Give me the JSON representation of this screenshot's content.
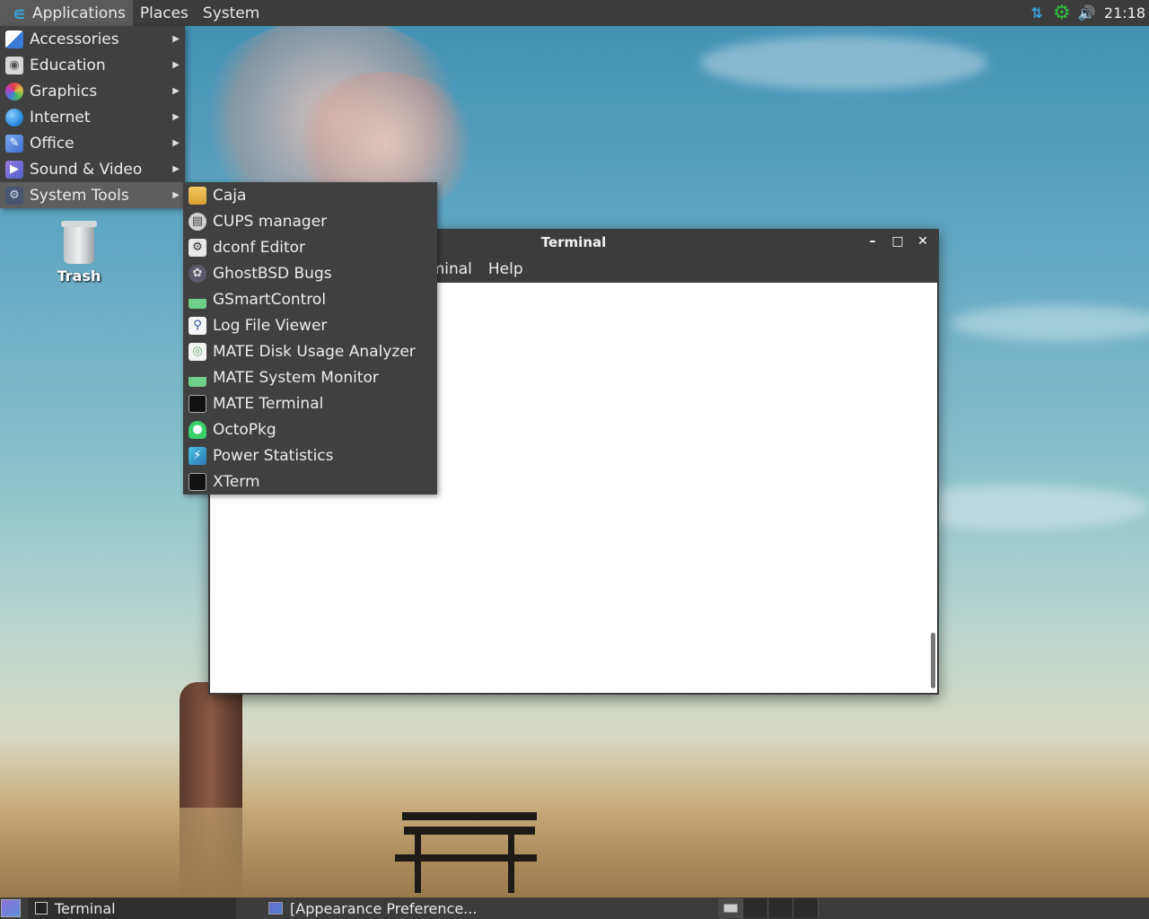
{
  "top_panel": {
    "menus": [
      "Applications",
      "Places",
      "System"
    ],
    "clock": "21:18",
    "tray_icons": [
      "network-icon",
      "update-gear-icon",
      "volume-icon"
    ]
  },
  "applications_menu": {
    "items": [
      {
        "label": "Accessories",
        "icon": "accessories-icon",
        "color": "#3b7ad6"
      },
      {
        "label": "Education",
        "icon": "education-icon",
        "color": "#cfcfcf"
      },
      {
        "label": "Graphics",
        "icon": "graphics-icon",
        "color": "#e04040"
      },
      {
        "label": "Internet",
        "icon": "internet-icon",
        "color": "#2d8ce0"
      },
      {
        "label": "Office",
        "icon": "office-icon",
        "color": "#5a8fe0"
      },
      {
        "label": "Sound & Video",
        "icon": "sound-video-icon",
        "color": "#7a5ad0"
      },
      {
        "label": "System Tools",
        "icon": "system-tools-icon",
        "color": "#9aa8c8"
      }
    ],
    "selected": "System Tools"
  },
  "system_tools_menu": {
    "items": [
      {
        "label": "Caja",
        "icon": "folder-icon"
      },
      {
        "label": "CUPS manager",
        "icon": "printer-icon"
      },
      {
        "label": "dconf Editor",
        "icon": "dconf-icon"
      },
      {
        "label": "GhostBSD Bugs",
        "icon": "bugs-icon"
      },
      {
        "label": "GSmartControl",
        "icon": "gsmartcontrol-icon"
      },
      {
        "label": "Log File Viewer",
        "icon": "log-viewer-icon"
      },
      {
        "label": "MATE Disk Usage Analyzer",
        "icon": "disk-usage-icon"
      },
      {
        "label": "MATE System Monitor",
        "icon": "system-monitor-icon"
      },
      {
        "label": "MATE Terminal",
        "icon": "terminal-icon"
      },
      {
        "label": "OctoPkg",
        "icon": "octopkg-icon"
      },
      {
        "label": "Power Statistics",
        "icon": "power-stats-icon"
      },
      {
        "label": "XTerm",
        "icon": "xterm-icon"
      }
    ]
  },
  "desktop": {
    "trash_label": "Trash"
  },
  "terminal_window": {
    "title": "Terminal",
    "menu_terminal": "rminal",
    "menu_help": "Help"
  },
  "bottom_panel": {
    "tasks": [
      "Terminal",
      "[Appearance Preference..."
    ]
  }
}
